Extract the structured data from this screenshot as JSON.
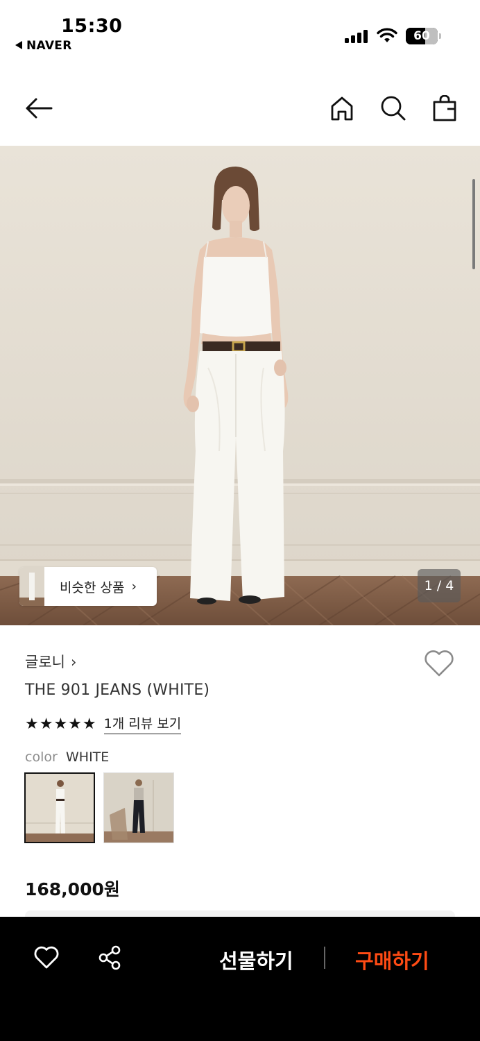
{
  "status_bar": {
    "time": "15:30",
    "back_app": "NAVER",
    "battery_level": "60",
    "battery_fraction": 0.6
  },
  "nav": {
    "back_icon": "arrow-left-icon",
    "home_icon": "home-icon",
    "search_icon": "search-icon",
    "bag_icon": "shopping-bag-icon"
  },
  "hero": {
    "similar_products_label": "비슷한 상품",
    "similar_chevron": "›",
    "pager": "1 / 4"
  },
  "product": {
    "brand": "글로니",
    "brand_chevron": "›",
    "name": "THE 901 JEANS (WHITE)",
    "stars": "★★★★★",
    "rating": 5,
    "review_link": "1개 리뷰 보기",
    "color_label": "color",
    "color_value": "WHITE",
    "swatches": [
      "WHITE",
      "BLACK"
    ],
    "selected_swatch": "WHITE",
    "price": "168,000원",
    "wishlisted": false
  },
  "bottom_bar": {
    "like_icon": "heart-icon",
    "share_icon": "share-icon",
    "gift_label": "선물하기",
    "buy_label": "구매하기",
    "buy_color": "#ff4b14"
  }
}
